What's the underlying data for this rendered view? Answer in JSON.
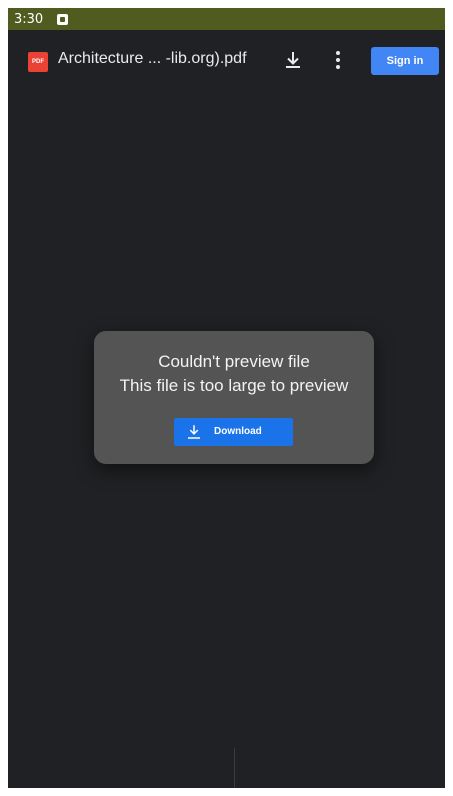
{
  "status_bar": {
    "time": "3:30",
    "bg_color": "#4f5b1f"
  },
  "toolbar": {
    "file_icon_label": "PDF",
    "file_title": "Architecture ... -lib.org).pdf",
    "download_icon": "download-icon",
    "more_icon": "more-vert-icon",
    "sign_in_label": "Sign in",
    "accent": "#4285f4"
  },
  "dialog": {
    "line1": "Couldn't preview file",
    "line2": "This file is too large to preview",
    "download_label": "Download",
    "download_icon": "download-icon",
    "button_color": "#1a73e8"
  },
  "background_color": "#202124"
}
